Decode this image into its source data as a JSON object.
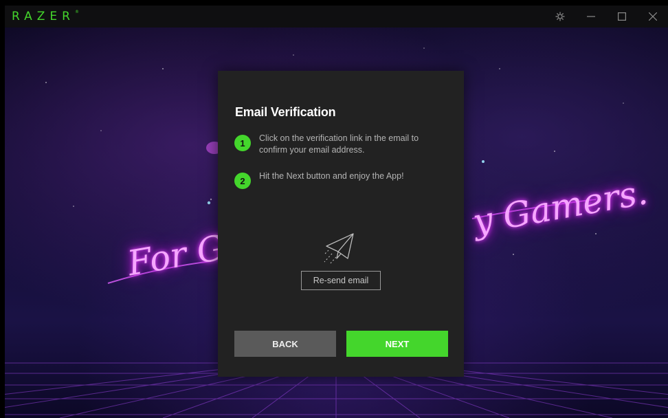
{
  "titlebar": {
    "logo": "RAZER",
    "logo_mark": "®",
    "icons": [
      "settings-icon",
      "minimize-icon",
      "maximize-icon",
      "close-icon"
    ]
  },
  "background": {
    "neon_left": "For Ga",
    "neon_right": "y Gamers."
  },
  "dialog": {
    "title": "Email Verification",
    "steps": [
      {
        "number": "1",
        "text": "Click on the verification link in the email to confirm your email address."
      },
      {
        "number": "2",
        "text": "Hit the Next button and enjoy the App!"
      }
    ],
    "icon": "paper-plane-icon",
    "resend_label": "Re-send email",
    "back_label": "BACK",
    "next_label": "NEXT"
  },
  "colors": {
    "accent": "#44d62c",
    "dialog_bg": "#222222",
    "back_button": "#5a5a5a"
  }
}
